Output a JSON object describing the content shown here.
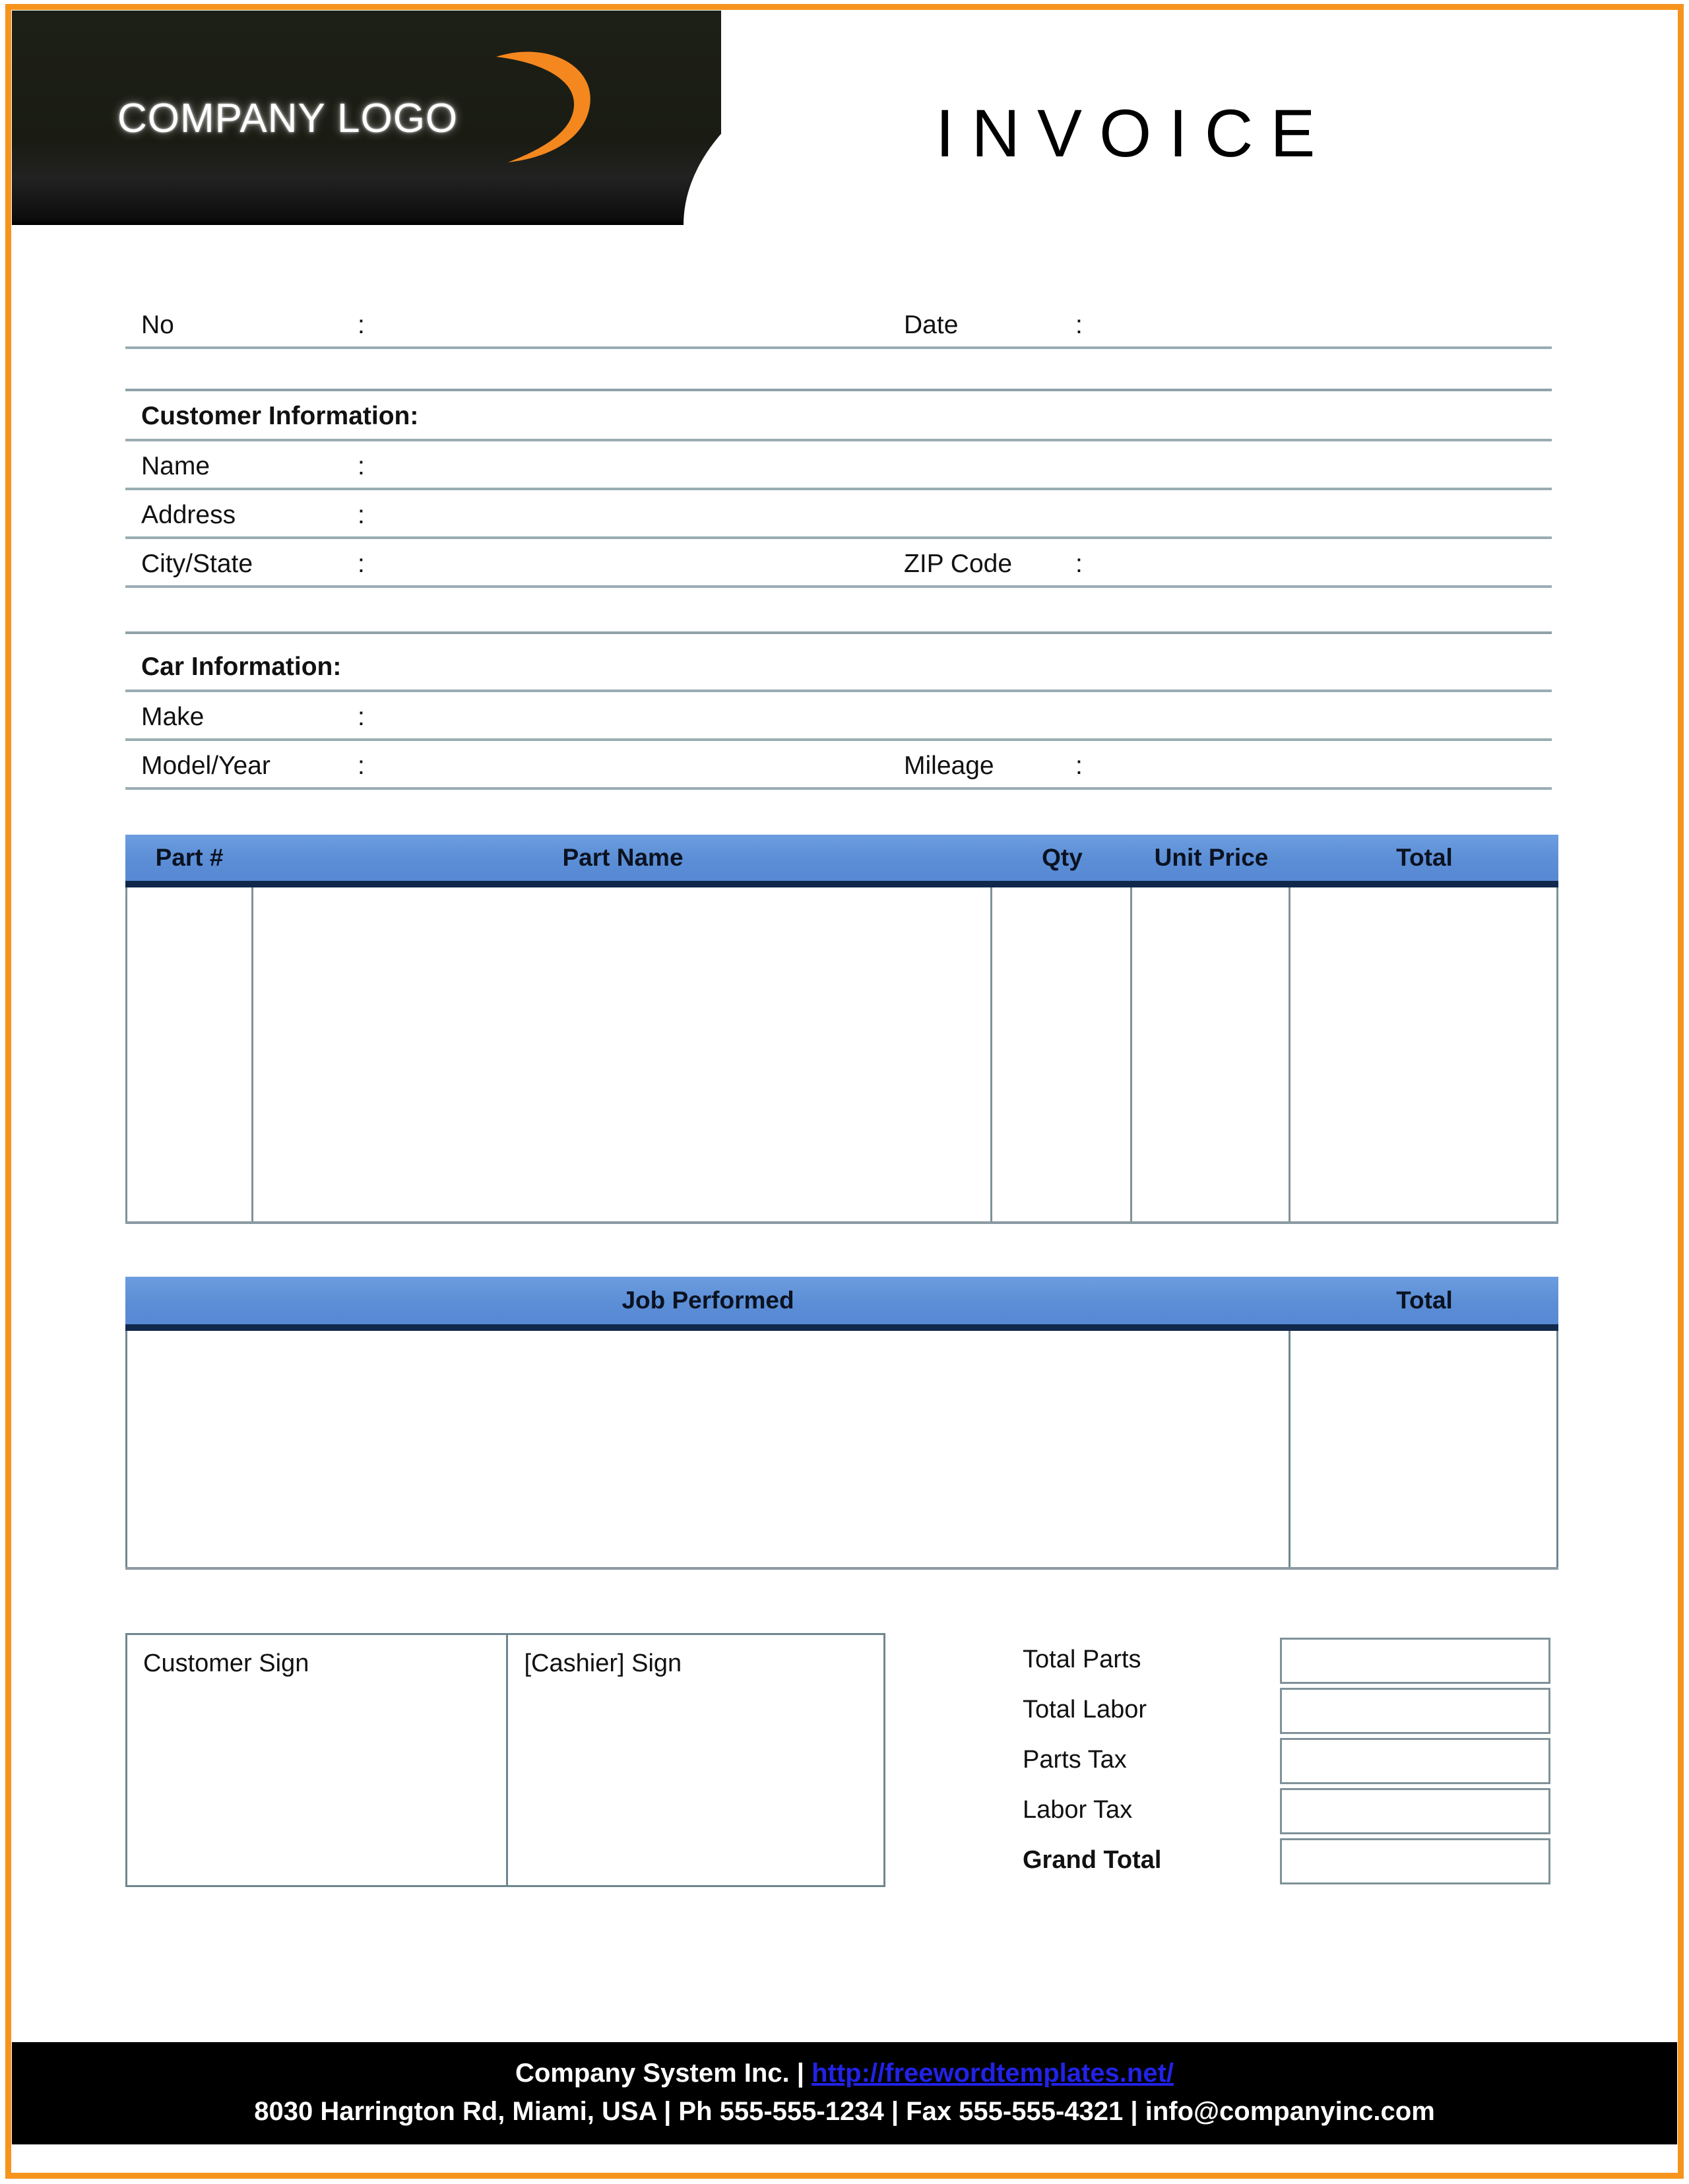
{
  "document": {
    "title": "INVOICE",
    "logo_text": "COMPANY LOGO"
  },
  "theme": {
    "page_border": "#F7941E",
    "header_black": "#1b1d14",
    "table_header_blue": "#5b8ed6",
    "table_header_underline": "#10284b",
    "rule_color": "#9aacb3",
    "link_blue": "#2222e8"
  },
  "meta": {
    "no_label": "No",
    "no_colon": ":",
    "no_value": "",
    "date_label": "Date",
    "date_colon": ":",
    "date_value": ""
  },
  "customer": {
    "section_title": "Customer Information:",
    "fields": [
      {
        "label": "Name",
        "colon": ":",
        "value": ""
      },
      {
        "label": "Address",
        "colon": ":",
        "value": ""
      },
      {
        "label": "City/State",
        "colon": ":",
        "value": "",
        "label2": "ZIP Code",
        "colon2": ":",
        "value2": ""
      }
    ]
  },
  "car": {
    "section_title": "Car Information:",
    "fields": [
      {
        "label": "Make",
        "colon": ":",
        "value": ""
      },
      {
        "label": "Model/Year",
        "colon": ":",
        "value": "",
        "label2": "Mileage",
        "colon2": ":",
        "value2": ""
      }
    ]
  },
  "parts_table": {
    "columns": [
      "Part #",
      "Part Name",
      "Qty",
      "Unit Price",
      "Total"
    ],
    "rows": []
  },
  "job_table": {
    "columns": [
      "Job Performed",
      "Total"
    ],
    "rows": []
  },
  "signatures": {
    "customer": "Customer Sign",
    "cashier": "[Cashier] Sign"
  },
  "totals": {
    "rows": [
      {
        "label": "Total Parts",
        "value": ""
      },
      {
        "label": "Total Labor",
        "value": ""
      },
      {
        "label": "Parts Tax",
        "value": ""
      },
      {
        "label": "Labor Tax",
        "value": ""
      },
      {
        "label": "Grand Total",
        "value": "",
        "bold": true
      }
    ]
  },
  "footer": {
    "company": "Company System Inc. | ",
    "url": "http://freewordtemplates.net/",
    "address_line": "8030 Harrington Rd, Miami, USA | Ph 555-555-1234 | Fax 555-555-4321 | info@companyinc.com"
  }
}
